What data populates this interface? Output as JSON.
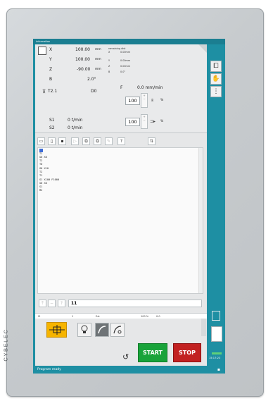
{
  "brand": "CYBELEC",
  "window": {
    "title": "information"
  },
  "axes": [
    {
      "name": "X",
      "value": "100.00",
      "unit": "mm"
    },
    {
      "name": "Y",
      "value": "100.00",
      "unit": "mm"
    },
    {
      "name": "Z",
      "value": "-90.00",
      "unit": "mm"
    },
    {
      "name": "B",
      "value": "2.0°",
      "unit": ""
    }
  ],
  "secondary_axes": {
    "header": "remaining dist",
    "rows": [
      {
        "name": "X",
        "value": "0.00mm"
      },
      {
        "name": "Y",
        "value": "0.00mm"
      },
      {
        "name": "Z",
        "value": "0.00mm"
      },
      {
        "name": "B",
        "value": "0.0°"
      }
    ]
  },
  "tool": {
    "label": "T2.1",
    "offset": "D0"
  },
  "feed": {
    "label": "F",
    "value": "0.0 mm/min",
    "override": "100",
    "override_unit": "%"
  },
  "spindles": [
    {
      "label": "S1",
      "value": "0 t/min"
    },
    {
      "label": "S2",
      "value": "0 t/min"
    }
  ],
  "spindle_override": {
    "value": "100",
    "unit": "%"
  },
  "program": {
    "lines": [
      "T1",
      "G0 X0",
      "T2",
      "T0",
      "G0 X10",
      "T2",
      "T1",
      "G1 X100 F1000",
      "G0 X0",
      "S1",
      "M2"
    ],
    "selected_index": 0,
    "goto_value": "11"
  },
  "table_row": {
    "c1": "f1",
    "c2": "1",
    "c3": "Ext",
    "c4": "100 %",
    "c5": "0.0"
  },
  "buttons": {
    "start": "START",
    "stop": "STOP"
  },
  "status": {
    "message": "Program ready",
    "time": "15:17:23"
  },
  "colors": {
    "accent": "#1e8fa3",
    "start": "#19a33a",
    "stop": "#c22121",
    "highlight": "#f6b400"
  }
}
